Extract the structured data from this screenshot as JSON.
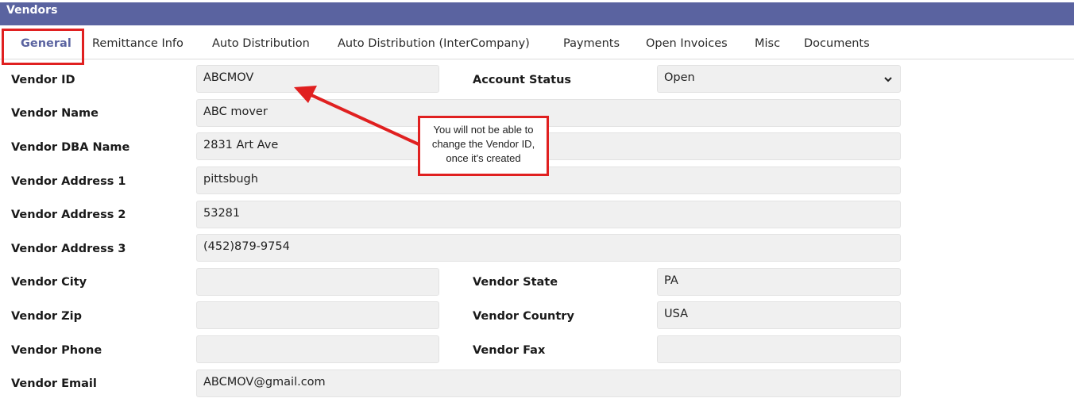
{
  "window": {
    "title": "Vendors"
  },
  "tabs": [
    {
      "label": "General",
      "active": true
    },
    {
      "label": "Remittance Info"
    },
    {
      "label": "Auto Distribution"
    },
    {
      "label": "Auto Distribution (InterCompany)"
    },
    {
      "label": "Payments"
    },
    {
      "label": "Open Invoices"
    },
    {
      "label": "Misc"
    },
    {
      "label": "Documents"
    }
  ],
  "form": {
    "vendor_id": {
      "label": "Vendor ID",
      "value": "ABCMOV"
    },
    "account_status": {
      "label": "Account Status",
      "value": "Open"
    },
    "vendor_name": {
      "label": "Vendor Name",
      "value": "ABC mover"
    },
    "vendor_dba_name": {
      "label": "Vendor DBA Name",
      "value": "2831 Art Ave"
    },
    "vendor_address_1": {
      "label": "Vendor Address 1",
      "value": "pittsbugh"
    },
    "vendor_address_2": {
      "label": "Vendor Address 2",
      "value": "53281"
    },
    "vendor_address_3": {
      "label": "Vendor Address 3",
      "value": "(452)879-9754"
    },
    "vendor_city": {
      "label": "Vendor City",
      "value": ""
    },
    "vendor_state": {
      "label": "Vendor State",
      "value": "PA"
    },
    "vendor_zip": {
      "label": "Vendor Zip",
      "value": ""
    },
    "vendor_country": {
      "label": "Vendor Country",
      "value": "USA"
    },
    "vendor_phone": {
      "label": "Vendor Phone",
      "value": ""
    },
    "vendor_fax": {
      "label": "Vendor Fax",
      "value": ""
    },
    "vendor_email": {
      "label": "Vendor Email",
      "value": "ABCMOV@gmail.com"
    }
  },
  "annotation": {
    "line1": "You will not be able to",
    "line2": "change the Vendor ID,",
    "line3": "once it's created",
    "color": "#e02020"
  },
  "colors": {
    "header": "#5a63a0",
    "field_bg": "#f0f0f0",
    "highlight": "#e02020"
  }
}
